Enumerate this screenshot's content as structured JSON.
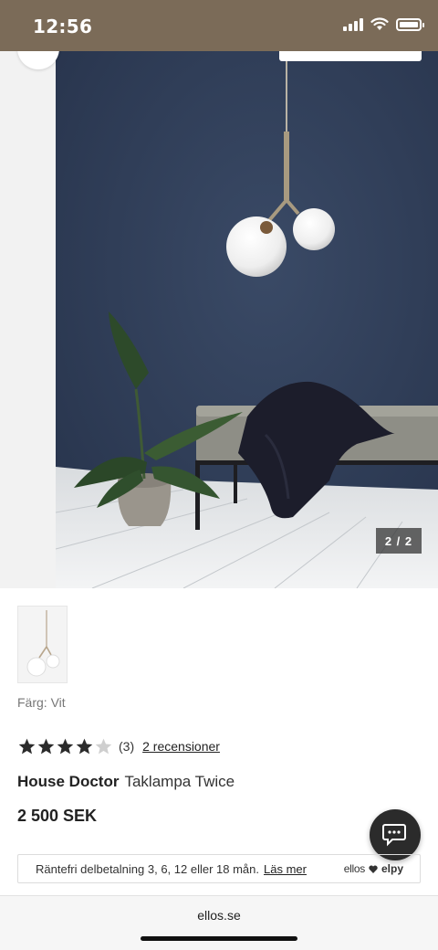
{
  "status_bar": {
    "time": "12:56"
  },
  "gallery": {
    "counter": "2 / 2"
  },
  "product": {
    "color_label": "Färg: Vit",
    "rating": {
      "value": 4,
      "max": 5,
      "count": "(3)",
      "reviews_link": "2 recensioner"
    },
    "brand": "House Doctor",
    "name": "Taklampa Twice",
    "price": "2 500 SEK"
  },
  "financing": {
    "text": "Räntefri delbetalning 3, 6, 12 eller 18 mån.",
    "link": "Läs mer",
    "logo_ellos": "ellos",
    "logo_elpy": "elpy"
  },
  "browser": {
    "url": "ellos.se"
  },
  "colors": {
    "status_bar_bg": "#7b6b58",
    "wall": "#2f3e59",
    "chat_button": "#2b2b2b"
  }
}
